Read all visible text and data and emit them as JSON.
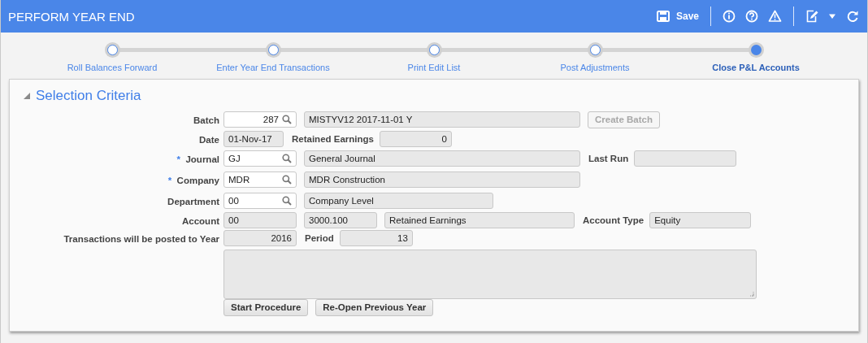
{
  "window": {
    "title": "PERFORM YEAR END"
  },
  "toolbar": {
    "save": "Save"
  },
  "steps": [
    {
      "label": "Roll Balances Forward",
      "selected": false
    },
    {
      "label": "Enter Year End Transactions",
      "selected": false
    },
    {
      "label": "Print Edit List",
      "selected": false
    },
    {
      "label": "Post Adjustments",
      "selected": false
    },
    {
      "label": "Close P&L Accounts",
      "selected": true
    }
  ],
  "section": {
    "title": "Selection Criteria",
    "expanded": true
  },
  "rows": [
    {
      "label": "Batch",
      "items": [
        {
          "kind": "lookup",
          "value": "287"
        },
        {
          "kind": "display",
          "value": "MISTYV12 2017-11-01 Y"
        },
        {
          "kind": "button",
          "label": "Create Batch",
          "disabled": true
        }
      ]
    },
    {
      "label": "Date",
      "items": [
        {
          "kind": "display",
          "value": "01-Nov-17"
        },
        {
          "kind": "label",
          "label": "Retained Earnings"
        },
        {
          "kind": "display",
          "value": "0"
        }
      ]
    },
    {
      "marker": "*",
      "label": "Journal",
      "items": [
        {
          "kind": "lookup",
          "value": "GJ"
        },
        {
          "kind": "display",
          "value": "General Journal"
        },
        {
          "kind": "label",
          "label": "Last Run"
        },
        {
          "kind": "display"
        }
      ]
    },
    {
      "marker": "*",
      "label": "Company",
      "items": [
        {
          "kind": "lookup",
          "value": "MDR"
        },
        {
          "kind": "display",
          "value": "MDR Construction"
        }
      ]
    },
    {
      "label": "Department",
      "items": [
        {
          "kind": "lookup",
          "value": "00"
        },
        {
          "kind": "display",
          "value": "Company Level"
        }
      ]
    },
    {
      "label": "Account",
      "items": [
        {
          "kind": "display",
          "value": "00"
        },
        {
          "kind": "display",
          "value": "3000.100"
        },
        {
          "kind": "display",
          "value": "Retained Earnings"
        },
        {
          "kind": "label",
          "label": "Account Type"
        },
        {
          "kind": "display",
          "value": "Equity"
        }
      ]
    },
    {
      "label": "Transactions will be posted to Year",
      "items": [
        {
          "kind": "display",
          "value": "2016"
        },
        {
          "kind": "label",
          "label": "Period"
        },
        {
          "kind": "display",
          "value": "13"
        }
      ]
    },
    {
      "items": [
        {
          "kind": "textarea"
        }
      ]
    },
    {
      "items": [
        {
          "kind": "button",
          "label": "Start Procedure",
          "disabled": false
        },
        {
          "kind": "button",
          "label": "Re-Open Previous Year",
          "disabled": false
        }
      ]
    }
  ]
}
